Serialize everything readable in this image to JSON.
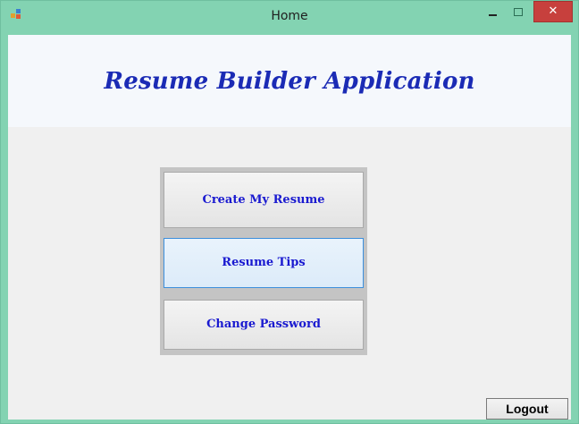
{
  "window": {
    "title": "Home",
    "close_glyph": "✕"
  },
  "header": {
    "title": "Resume Builder Application"
  },
  "menu": {
    "buttons": [
      {
        "label": "Create My Resume"
      },
      {
        "label": "Resume Tips"
      },
      {
        "label": "Change Password"
      }
    ]
  },
  "footer": {
    "logout_label": "Logout"
  },
  "colors": {
    "titlebar": "#83d3b2",
    "close_button": "#c7403d",
    "header_title": "#1b2bb5",
    "menu_button_text": "#1a1ad0",
    "focused_border": "#3c8fdc"
  },
  "icons": {
    "app": "windows-form-icon",
    "minimize": "minimize-icon",
    "maximize": "maximize-icon",
    "close": "close-icon"
  }
}
